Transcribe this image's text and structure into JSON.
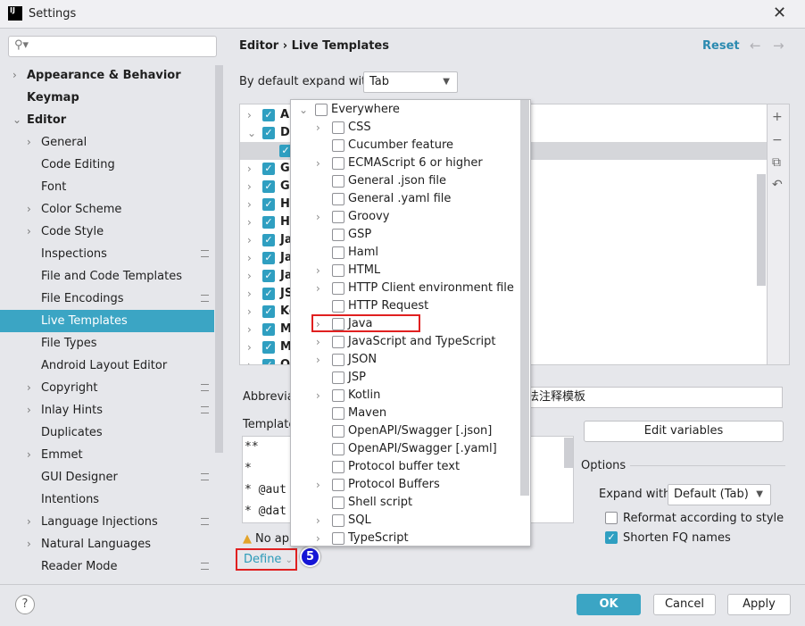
{
  "window": {
    "title": "Settings",
    "logo": "IJ",
    "close": "✕"
  },
  "search": {
    "icon": "search-icon",
    "placeholder": ""
  },
  "sidebar": {
    "items": [
      {
        "label": "Appearance & Behavior",
        "level": 0,
        "bold": true,
        "chevron": "›"
      },
      {
        "label": "Keymap",
        "level": 0,
        "bold": true,
        "chevron": ""
      },
      {
        "label": "Editor",
        "level": 0,
        "bold": true,
        "chevron": "⌄"
      },
      {
        "label": "General",
        "level": 1,
        "chevron": "›"
      },
      {
        "label": "Code Editing",
        "level": 1,
        "chevron": ""
      },
      {
        "label": "Font",
        "level": 1,
        "chevron": ""
      },
      {
        "label": "Color Scheme",
        "level": 1,
        "chevron": "›"
      },
      {
        "label": "Code Style",
        "level": 1,
        "chevron": "›"
      },
      {
        "label": "Inspections",
        "level": 1,
        "chevron": "",
        "gear": true
      },
      {
        "label": "File and Code Templates",
        "level": 1,
        "chevron": ""
      },
      {
        "label": "File Encodings",
        "level": 1,
        "chevron": "",
        "gear": true
      },
      {
        "label": "Live Templates",
        "level": 1,
        "chevron": "",
        "selected": true
      },
      {
        "label": "File Types",
        "level": 1,
        "chevron": ""
      },
      {
        "label": "Android Layout Editor",
        "level": 1,
        "chevron": ""
      },
      {
        "label": "Copyright",
        "level": 1,
        "chevron": "›",
        "gear": true
      },
      {
        "label": "Inlay Hints",
        "level": 1,
        "chevron": "›",
        "gear": true
      },
      {
        "label": "Duplicates",
        "level": 1,
        "chevron": ""
      },
      {
        "label": "Emmet",
        "level": 1,
        "chevron": "›"
      },
      {
        "label": "GUI Designer",
        "level": 1,
        "chevron": "",
        "gear": true
      },
      {
        "label": "Intentions",
        "level": 1,
        "chevron": ""
      },
      {
        "label": "Language Injections",
        "level": 1,
        "chevron": "›",
        "gear": true
      },
      {
        "label": "Natural Languages",
        "level": 1,
        "chevron": "›"
      },
      {
        "label": "Reader Mode",
        "level": 1,
        "chevron": "",
        "gear": true
      }
    ]
  },
  "header": {
    "crumb_parent": "Editor",
    "crumb_sep": "›",
    "crumb_current": "Live Templates",
    "reset": "Reset",
    "back": "←",
    "forward": "→"
  },
  "expand": {
    "label": "By default expand with",
    "value": "Tab"
  },
  "tree": {
    "rows": [
      {
        "label": "An",
        "chevron": "›"
      },
      {
        "label": "DI",
        "chevron": "⌄"
      },
      {
        "label": "",
        "child": true,
        "selected": true
      },
      {
        "label": "Gr",
        "chevron": "›"
      },
      {
        "label": "GS",
        "chevron": "›"
      },
      {
        "label": "HT",
        "chevron": "›"
      },
      {
        "label": "HT",
        "chevron": "›"
      },
      {
        "label": "Ja",
        "chevron": "›"
      },
      {
        "label": "Ja",
        "chevron": "›"
      },
      {
        "label": "Ja",
        "chevron": "›"
      },
      {
        "label": "JS",
        "chevron": "›"
      },
      {
        "label": "Ko",
        "chevron": "›"
      },
      {
        "label": "M",
        "chevron": "›"
      },
      {
        "label": "M",
        "chevron": "›"
      },
      {
        "label": "O",
        "chevron": "›"
      }
    ],
    "tools": [
      "+",
      "−",
      "⧉",
      "↶"
    ]
  },
  "popup": {
    "items": [
      {
        "label": "Everywhere",
        "chevron": "⌄",
        "root": true
      },
      {
        "label": "CSS",
        "chevron": "›"
      },
      {
        "label": "Cucumber feature",
        "chevron": ""
      },
      {
        "label": "ECMAScript 6 or higher",
        "chevron": "›"
      },
      {
        "label": "General .json file",
        "chevron": ""
      },
      {
        "label": "General .yaml file",
        "chevron": ""
      },
      {
        "label": "Groovy",
        "chevron": "›"
      },
      {
        "label": "GSP",
        "chevron": ""
      },
      {
        "label": "Haml",
        "chevron": ""
      },
      {
        "label": "HTML",
        "chevron": "›"
      },
      {
        "label": "HTTP Client environment file",
        "chevron": "›"
      },
      {
        "label": "HTTP Request",
        "chevron": ""
      },
      {
        "label": "Java",
        "chevron": "›"
      },
      {
        "label": "JavaScript and TypeScript",
        "chevron": "›"
      },
      {
        "label": "JSON",
        "chevron": "›"
      },
      {
        "label": "JSP",
        "chevron": ""
      },
      {
        "label": "Kotlin",
        "chevron": "›"
      },
      {
        "label": "Maven",
        "chevron": ""
      },
      {
        "label": "OpenAPI/Swagger [.json]",
        "chevron": ""
      },
      {
        "label": "OpenAPI/Swagger [.yaml]",
        "chevron": ""
      },
      {
        "label": "Protocol buffer text",
        "chevron": ""
      },
      {
        "label": "Protocol Buffers",
        "chevron": "›"
      },
      {
        "label": "Shell script",
        "chevron": ""
      },
      {
        "label": "SQL",
        "chevron": "›"
      },
      {
        "label": "TypeScript",
        "chevron": "›"
      }
    ]
  },
  "editor": {
    "abbr_label": "Abbreviat",
    "abbr_value": "法注释模板",
    "template_label": "Template",
    "template_lines": [
      "**",
      " *",
      " * @aut",
      " * @dat"
    ],
    "warning": "No ap",
    "define": "Define",
    "define_chevron": "⌄",
    "badge": "5",
    "edit_vars": "Edit variables",
    "options": "Options",
    "expand_with_label": "Expand with",
    "expand_with_value": "Default (Tab)",
    "reformat": "Reformat according to style",
    "reformat_checked": false,
    "shorten": "Shorten FQ names",
    "shorten_checked": true
  },
  "footer": {
    "help": "?",
    "ok": "OK",
    "cancel": "Cancel",
    "apply": "Apply"
  },
  "colors": {
    "accent": "#3ba5c4",
    "highlight_box": "#e02020",
    "badge": "#1515d6"
  }
}
